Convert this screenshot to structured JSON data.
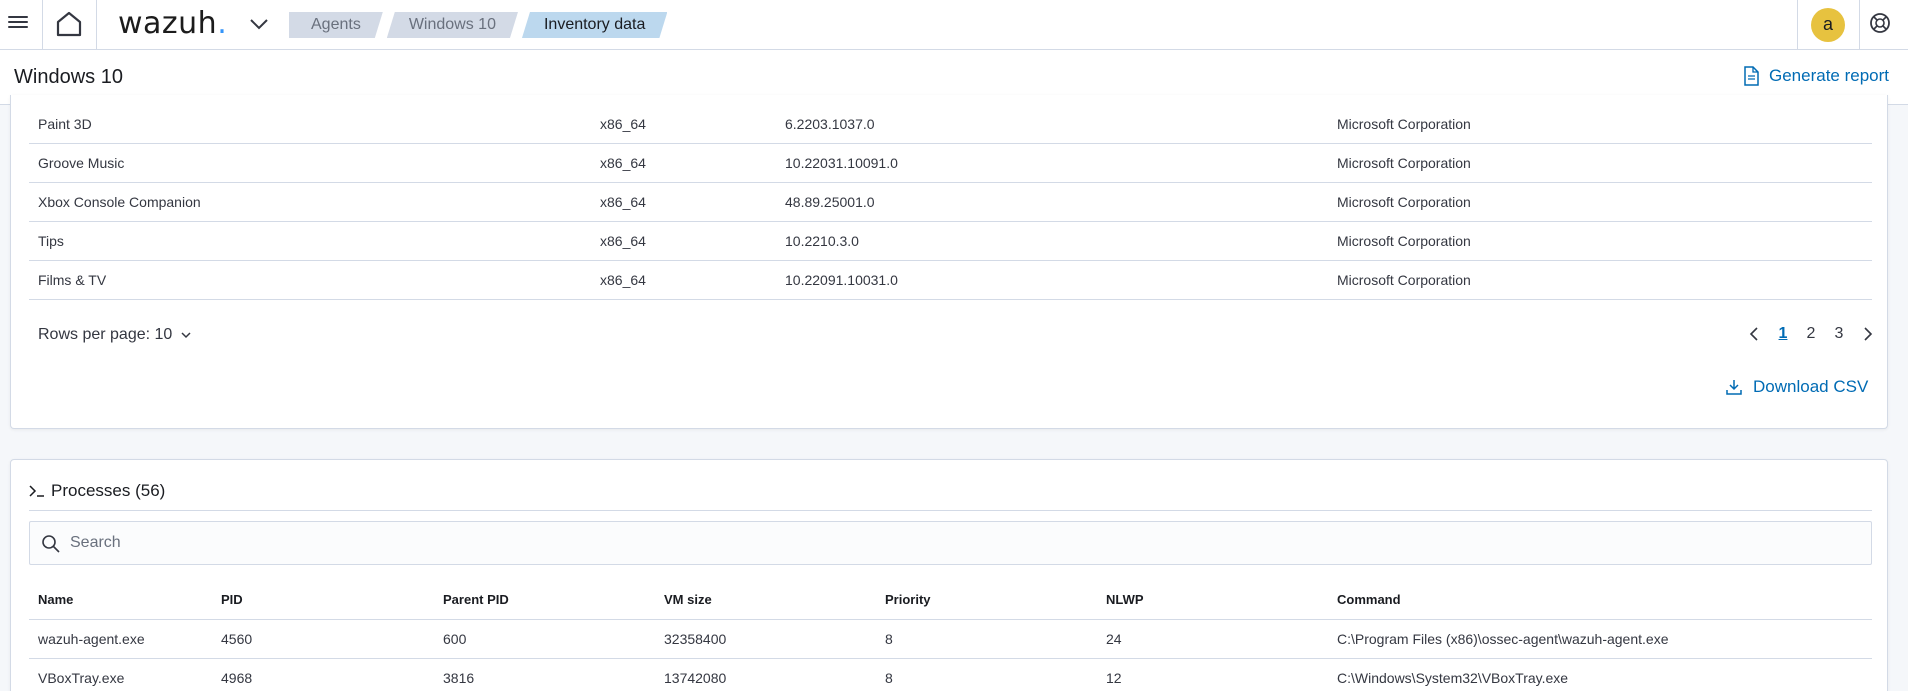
{
  "nav": {
    "logo": "wazuh",
    "logo_dot": ".",
    "breadcrumbs": [
      "Agents",
      "Windows 10",
      "Inventory data"
    ],
    "avatar_letter": "a"
  },
  "header": {
    "title": "Windows 10",
    "generate_report": "Generate report"
  },
  "packages": {
    "rows": [
      {
        "name": "Paint 3D",
        "arch": "x86_64",
        "version": "6.2203.1037.0",
        "vendor": "Microsoft Corporation"
      },
      {
        "name": "Groove Music",
        "arch": "x86_64",
        "version": "10.22031.10091.0",
        "vendor": "Microsoft Corporation"
      },
      {
        "name": "Xbox Console Companion",
        "arch": "x86_64",
        "version": "48.89.25001.0",
        "vendor": "Microsoft Corporation"
      },
      {
        "name": "Tips",
        "arch": "x86_64",
        "version": "10.2210.3.0",
        "vendor": "Microsoft Corporation"
      },
      {
        "name": "Films & TV",
        "arch": "x86_64",
        "version": "10.22091.10031.0",
        "vendor": "Microsoft Corporation"
      }
    ],
    "rows_per_page": "Rows per page: 10",
    "pages": [
      "1",
      "2",
      "3"
    ],
    "current_page": "1",
    "download_csv": "Download CSV"
  },
  "processes": {
    "title": "Processes (56)",
    "search_placeholder": "Search",
    "columns": [
      "Name",
      "PID",
      "Parent PID",
      "VM size",
      "Priority",
      "NLWP",
      "Command"
    ],
    "rows": [
      {
        "name": "wazuh-agent.exe",
        "pid": "4560",
        "ppid": "600",
        "vm_size": "32358400",
        "priority": "8",
        "nlwp": "24",
        "command": "C:\\Program Files (x86)\\ossec-agent\\wazuh-agent.exe"
      },
      {
        "name": "VBoxTray.exe",
        "pid": "4968",
        "ppid": "3816",
        "vm_size": "13742080",
        "priority": "8",
        "nlwp": "12",
        "command": "C:\\Windows\\System32\\VBoxTray.exe"
      }
    ]
  },
  "colors": {
    "link": "#006bb4",
    "breadcrumb_active": "#bcd8ee",
    "avatar": "#e7c23f",
    "border": "#d3dae6"
  }
}
